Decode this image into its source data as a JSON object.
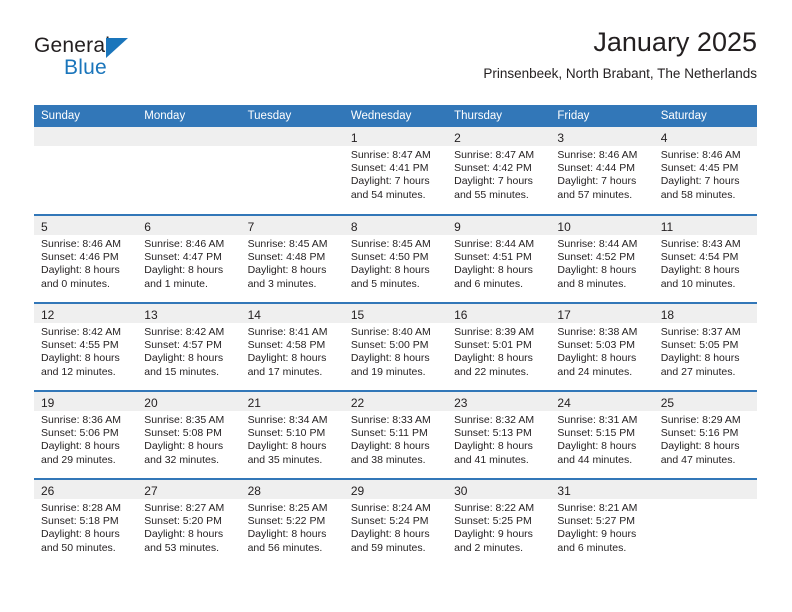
{
  "logo": {
    "word_top": "General",
    "word_bottom": "Blue",
    "triangle_icon": "triangle-icon",
    "blue": "#1a75bb"
  },
  "header": {
    "title": "January 2025",
    "subtitle": "Prinsenbeek, North Brabant, The Netherlands"
  },
  "theme": {
    "header_bar": "#3277b8",
    "daynum_band": "#efefef",
    "text": "#231f20"
  },
  "weekday_headers": [
    "Sunday",
    "Monday",
    "Tuesday",
    "Wednesday",
    "Thursday",
    "Friday",
    "Saturday"
  ],
  "labels": {
    "sunrise": "Sunrise:",
    "sunset": "Sunset:",
    "daylight": "Daylight:"
  },
  "weeks": [
    [
      {
        "day": ""
      },
      {
        "day": ""
      },
      {
        "day": ""
      },
      {
        "day": "1",
        "sunrise": "Sunrise: 8:47 AM",
        "sunset": "Sunset: 4:41 PM",
        "daylight_1": "Daylight: 7 hours",
        "daylight_2": "and 54 minutes."
      },
      {
        "day": "2",
        "sunrise": "Sunrise: 8:47 AM",
        "sunset": "Sunset: 4:42 PM",
        "daylight_1": "Daylight: 7 hours",
        "daylight_2": "and 55 minutes."
      },
      {
        "day": "3",
        "sunrise": "Sunrise: 8:46 AM",
        "sunset": "Sunset: 4:44 PM",
        "daylight_1": "Daylight: 7 hours",
        "daylight_2": "and 57 minutes."
      },
      {
        "day": "4",
        "sunrise": "Sunrise: 8:46 AM",
        "sunset": "Sunset: 4:45 PM",
        "daylight_1": "Daylight: 7 hours",
        "daylight_2": "and 58 minutes."
      }
    ],
    [
      {
        "day": "5",
        "sunrise": "Sunrise: 8:46 AM",
        "sunset": "Sunset: 4:46 PM",
        "daylight_1": "Daylight: 8 hours",
        "daylight_2": "and 0 minutes."
      },
      {
        "day": "6",
        "sunrise": "Sunrise: 8:46 AM",
        "sunset": "Sunset: 4:47 PM",
        "daylight_1": "Daylight: 8 hours",
        "daylight_2": "and 1 minute."
      },
      {
        "day": "7",
        "sunrise": "Sunrise: 8:45 AM",
        "sunset": "Sunset: 4:48 PM",
        "daylight_1": "Daylight: 8 hours",
        "daylight_2": "and 3 minutes."
      },
      {
        "day": "8",
        "sunrise": "Sunrise: 8:45 AM",
        "sunset": "Sunset: 4:50 PM",
        "daylight_1": "Daylight: 8 hours",
        "daylight_2": "and 5 minutes."
      },
      {
        "day": "9",
        "sunrise": "Sunrise: 8:44 AM",
        "sunset": "Sunset: 4:51 PM",
        "daylight_1": "Daylight: 8 hours",
        "daylight_2": "and 6 minutes."
      },
      {
        "day": "10",
        "sunrise": "Sunrise: 8:44 AM",
        "sunset": "Sunset: 4:52 PM",
        "daylight_1": "Daylight: 8 hours",
        "daylight_2": "and 8 minutes."
      },
      {
        "day": "11",
        "sunrise": "Sunrise: 8:43 AM",
        "sunset": "Sunset: 4:54 PM",
        "daylight_1": "Daylight: 8 hours",
        "daylight_2": "and 10 minutes."
      }
    ],
    [
      {
        "day": "12",
        "sunrise": "Sunrise: 8:42 AM",
        "sunset": "Sunset: 4:55 PM",
        "daylight_1": "Daylight: 8 hours",
        "daylight_2": "and 12 minutes."
      },
      {
        "day": "13",
        "sunrise": "Sunrise: 8:42 AM",
        "sunset": "Sunset: 4:57 PM",
        "daylight_1": "Daylight: 8 hours",
        "daylight_2": "and 15 minutes."
      },
      {
        "day": "14",
        "sunrise": "Sunrise: 8:41 AM",
        "sunset": "Sunset: 4:58 PM",
        "daylight_1": "Daylight: 8 hours",
        "daylight_2": "and 17 minutes."
      },
      {
        "day": "15",
        "sunrise": "Sunrise: 8:40 AM",
        "sunset": "Sunset: 5:00 PM",
        "daylight_1": "Daylight: 8 hours",
        "daylight_2": "and 19 minutes."
      },
      {
        "day": "16",
        "sunrise": "Sunrise: 8:39 AM",
        "sunset": "Sunset: 5:01 PM",
        "daylight_1": "Daylight: 8 hours",
        "daylight_2": "and 22 minutes."
      },
      {
        "day": "17",
        "sunrise": "Sunrise: 8:38 AM",
        "sunset": "Sunset: 5:03 PM",
        "daylight_1": "Daylight: 8 hours",
        "daylight_2": "and 24 minutes."
      },
      {
        "day": "18",
        "sunrise": "Sunrise: 8:37 AM",
        "sunset": "Sunset: 5:05 PM",
        "daylight_1": "Daylight: 8 hours",
        "daylight_2": "and 27 minutes."
      }
    ],
    [
      {
        "day": "19",
        "sunrise": "Sunrise: 8:36 AM",
        "sunset": "Sunset: 5:06 PM",
        "daylight_1": "Daylight: 8 hours",
        "daylight_2": "and 29 minutes."
      },
      {
        "day": "20",
        "sunrise": "Sunrise: 8:35 AM",
        "sunset": "Sunset: 5:08 PM",
        "daylight_1": "Daylight: 8 hours",
        "daylight_2": "and 32 minutes."
      },
      {
        "day": "21",
        "sunrise": "Sunrise: 8:34 AM",
        "sunset": "Sunset: 5:10 PM",
        "daylight_1": "Daylight: 8 hours",
        "daylight_2": "and 35 minutes."
      },
      {
        "day": "22",
        "sunrise": "Sunrise: 8:33 AM",
        "sunset": "Sunset: 5:11 PM",
        "daylight_1": "Daylight: 8 hours",
        "daylight_2": "and 38 minutes."
      },
      {
        "day": "23",
        "sunrise": "Sunrise: 8:32 AM",
        "sunset": "Sunset: 5:13 PM",
        "daylight_1": "Daylight: 8 hours",
        "daylight_2": "and 41 minutes."
      },
      {
        "day": "24",
        "sunrise": "Sunrise: 8:31 AM",
        "sunset": "Sunset: 5:15 PM",
        "daylight_1": "Daylight: 8 hours",
        "daylight_2": "and 44 minutes."
      },
      {
        "day": "25",
        "sunrise": "Sunrise: 8:29 AM",
        "sunset": "Sunset: 5:16 PM",
        "daylight_1": "Daylight: 8 hours",
        "daylight_2": "and 47 minutes."
      }
    ],
    [
      {
        "day": "26",
        "sunrise": "Sunrise: 8:28 AM",
        "sunset": "Sunset: 5:18 PM",
        "daylight_1": "Daylight: 8 hours",
        "daylight_2": "and 50 minutes."
      },
      {
        "day": "27",
        "sunrise": "Sunrise: 8:27 AM",
        "sunset": "Sunset: 5:20 PM",
        "daylight_1": "Daylight: 8 hours",
        "daylight_2": "and 53 minutes."
      },
      {
        "day": "28",
        "sunrise": "Sunrise: 8:25 AM",
        "sunset": "Sunset: 5:22 PM",
        "daylight_1": "Daylight: 8 hours",
        "daylight_2": "and 56 minutes."
      },
      {
        "day": "29",
        "sunrise": "Sunrise: 8:24 AM",
        "sunset": "Sunset: 5:24 PM",
        "daylight_1": "Daylight: 8 hours",
        "daylight_2": "and 59 minutes."
      },
      {
        "day": "30",
        "sunrise": "Sunrise: 8:22 AM",
        "sunset": "Sunset: 5:25 PM",
        "daylight_1": "Daylight: 9 hours",
        "daylight_2": "and 2 minutes."
      },
      {
        "day": "31",
        "sunrise": "Sunrise: 8:21 AM",
        "sunset": "Sunset: 5:27 PM",
        "daylight_1": "Daylight: 9 hours",
        "daylight_2": "and 6 minutes."
      },
      {
        "day": ""
      }
    ]
  ]
}
